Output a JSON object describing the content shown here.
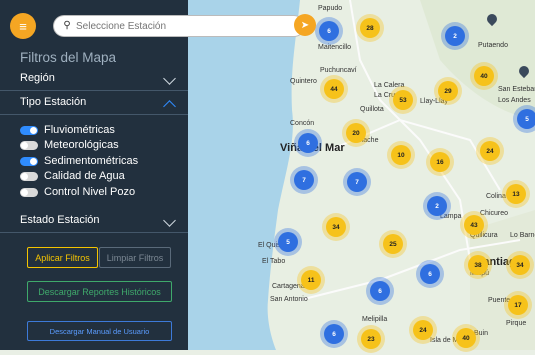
{
  "app": {
    "search_placeholder": "Seleccione Estación",
    "menu_icon": "menu-icon",
    "locate_icon": "locate-icon"
  },
  "sidebar": {
    "title": "Filtros del Mapa",
    "sections": {
      "region": "Región",
      "tipo": "Tipo Estación",
      "estado": "Estado Estación"
    },
    "options": [
      {
        "label": "Fluviométricas",
        "on": true
      },
      {
        "label": "Meteorológicas",
        "on": false
      },
      {
        "label": "Sedimentométricas",
        "on": true
      },
      {
        "label": "Calidad de Agua",
        "on": false
      },
      {
        "label": "Control Nivel Pozo",
        "on": false
      }
    ],
    "buttons": {
      "apply": "Aplicar Filtros",
      "clear": "Limpiar Filtros",
      "reports": "Descargar Reportes Históricos",
      "manual": "Descargar Manual de Usuario"
    }
  },
  "map": {
    "places": [
      "Papudo",
      "Putaendo",
      "Maitencillo",
      "Puchuncaví",
      "Quintero",
      "La Calera",
      "La Cruz",
      "Quillota",
      "Viña del Mar",
      "Limache",
      "Llay-Llay",
      "San Esteban",
      "Los Andes",
      "Concón",
      "Colina",
      "Chicureo",
      "Lampa",
      "Quilicura",
      "Lo Barnechea",
      "El Quisco",
      "El Tabo",
      "Cartagena",
      "San Antonio",
      "Santiago",
      "Maipú",
      "Puente Alto",
      "Pirque",
      "Melipilla",
      "Buin",
      "Isla de Maipo"
    ],
    "clusters": [
      {
        "n": "28",
        "c": "y"
      },
      {
        "n": "6",
        "c": "b"
      },
      {
        "n": "2",
        "c": "b"
      },
      {
        "n": "40",
        "c": "y"
      },
      {
        "n": "44",
        "c": "y"
      },
      {
        "n": "53",
        "c": "y"
      },
      {
        "n": "29",
        "c": "y"
      },
      {
        "n": "5",
        "c": "b"
      },
      {
        "n": "20",
        "c": "y"
      },
      {
        "n": "6",
        "c": "b"
      },
      {
        "n": "10",
        "c": "y"
      },
      {
        "n": "16",
        "c": "y"
      },
      {
        "n": "24",
        "c": "y"
      },
      {
        "n": "7",
        "c": "b"
      },
      {
        "n": "7",
        "c": "b"
      },
      {
        "n": "13",
        "c": "y"
      },
      {
        "n": "2",
        "c": "b"
      },
      {
        "n": "43",
        "c": "y"
      },
      {
        "n": "34",
        "c": "y"
      },
      {
        "n": "5",
        "c": "b"
      },
      {
        "n": "25",
        "c": "y"
      },
      {
        "n": "6",
        "c": "b"
      },
      {
        "n": "38",
        "c": "y"
      },
      {
        "n": "34",
        "c": "y"
      },
      {
        "n": "11",
        "c": "y"
      },
      {
        "n": "6",
        "c": "b"
      },
      {
        "n": "17",
        "c": "y"
      },
      {
        "n": "6",
        "c": "b"
      },
      {
        "n": "24",
        "c": "y"
      },
      {
        "n": "23",
        "c": "y"
      },
      {
        "n": "40",
        "c": "y"
      }
    ]
  }
}
